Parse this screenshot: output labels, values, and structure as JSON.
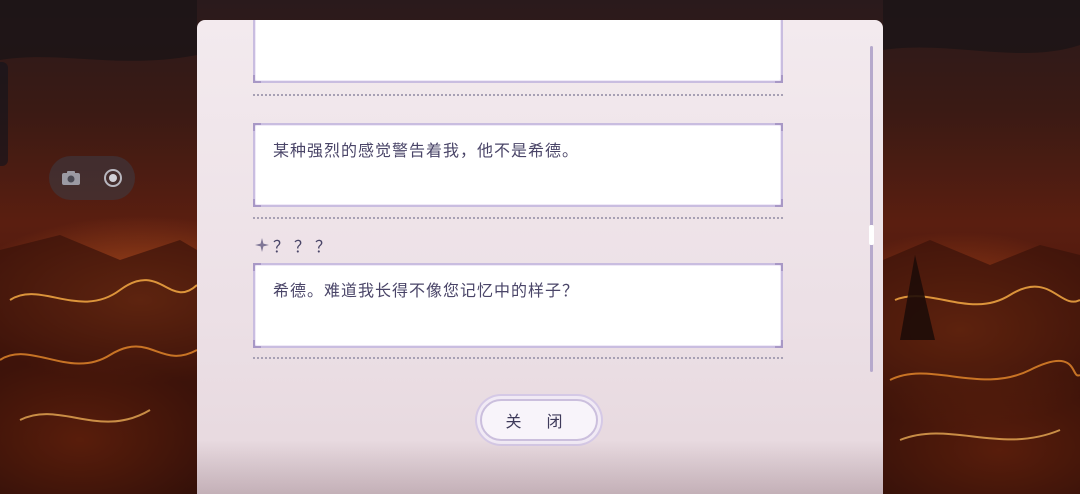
{
  "dialogue": {
    "entries": [
      {
        "speaker": "",
        "text": ""
      },
      {
        "speaker": "",
        "text": "某种强烈的感觉警告着我，他不是希德。"
      },
      {
        "speaker": "？？？",
        "text": "希德。难道我长得不像您记忆中的样子？"
      }
    ]
  },
  "controls": {
    "close_label": "关 闭"
  },
  "icons": {
    "camera": "camera-icon",
    "record": "record-icon",
    "speaker_mark": "sparkle-icon"
  },
  "colors": {
    "panel_bg": "#efe4e9",
    "box_border": "#c9bde0",
    "text": "#4a4568",
    "accent": "#b6a9cc"
  }
}
